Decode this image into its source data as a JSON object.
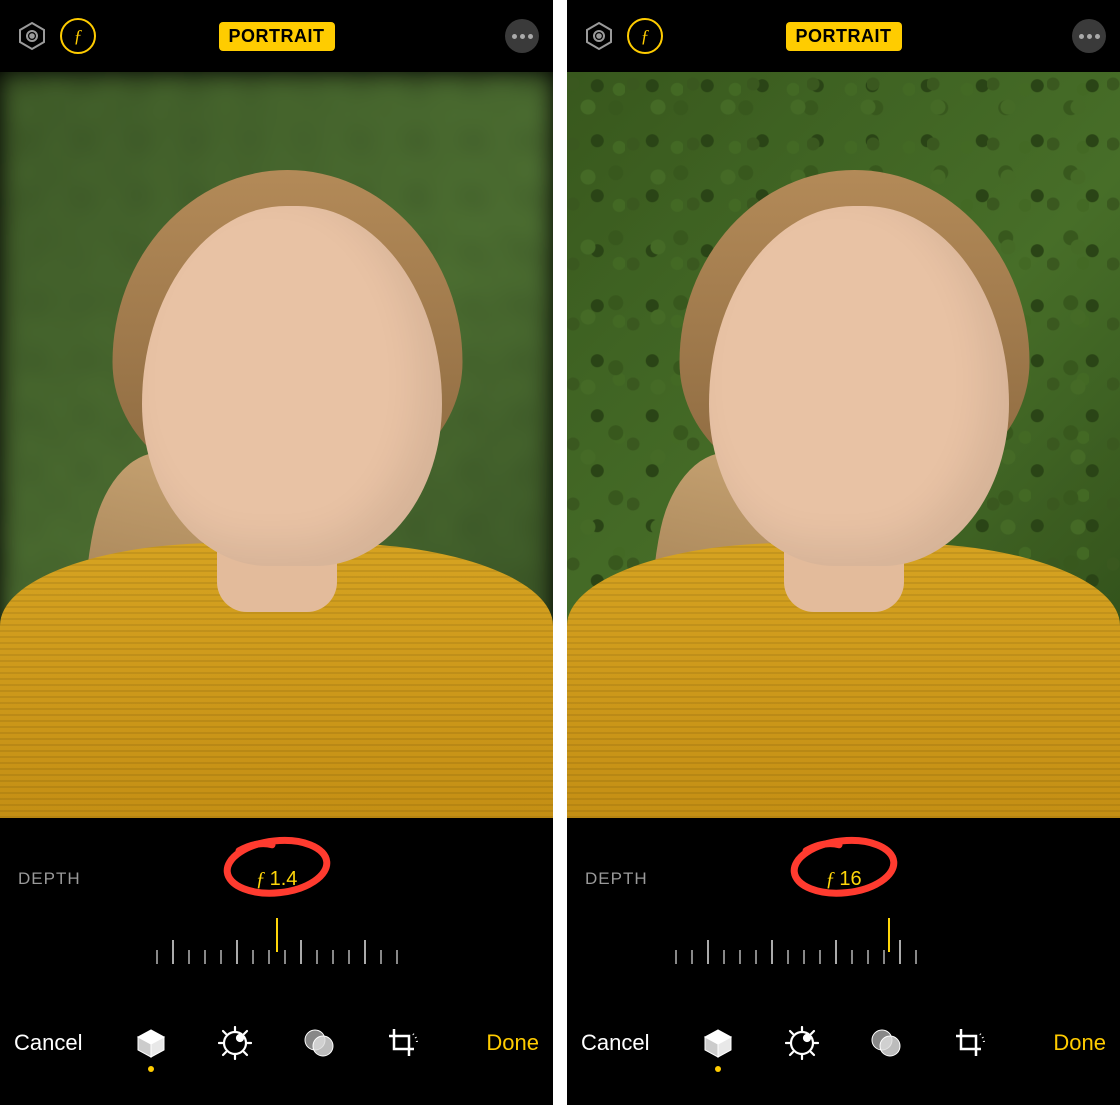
{
  "panes": [
    {
      "mode_badge": "PORTRAIT",
      "f_button_glyph": "ƒ",
      "depth_label": "DEPTH",
      "f_glyph": "ƒ",
      "f_value": "1.4",
      "blur": true,
      "cancel": "Cancel",
      "done": "Done",
      "tools": {
        "cube_selected": true
      }
    },
    {
      "mode_badge": "PORTRAIT",
      "f_button_glyph": "ƒ",
      "depth_label": "DEPTH",
      "f_glyph": "ƒ",
      "f_value": "16",
      "blur": false,
      "cancel": "Cancel",
      "done": "Done",
      "tools": {
        "cube_selected": true
      }
    }
  ],
  "annotation_color": "#ff3b2f"
}
